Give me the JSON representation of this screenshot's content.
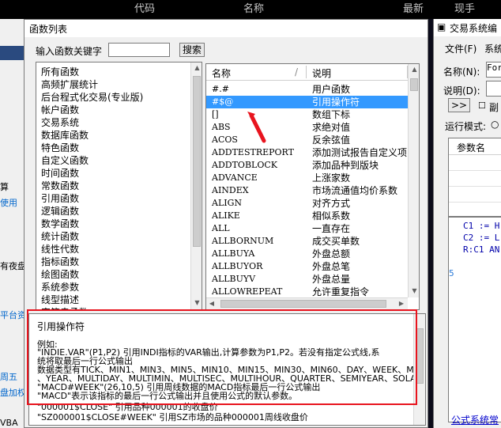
{
  "background_app": {
    "header_cols": [
      "代码",
      "名称",
      "最新",
      "现手"
    ],
    "left_side_texts": [
      "算",
      "使用",
      "有夜盘",
      "平台资",
      "周五",
      "盘加权",
      "VBA"
    ]
  },
  "dialog": {
    "title": "函数列表",
    "keyword_label": "输入函数关键字",
    "keyword_value": "",
    "search_button": "搜索",
    "categories": [
      "所有函数",
      "高频扩展统计",
      "后台程式化交易(专业版)",
      "帐户函数",
      "交易系统",
      "数据库函数",
      "特色函数",
      "自定义函数",
      "时间函数",
      "常数函数",
      "引用函数",
      "逻辑函数",
      "数学函数",
      "统计函数",
      "线性代数",
      "指标函数",
      "绘图函数",
      "系统参数",
      "线型描述",
      "字符串函数"
    ],
    "table": {
      "col_name": "名称",
      "col_desc": "说明",
      "sort_indicator": "/",
      "rows": [
        {
          "name": "#.#",
          "desc": "用户函数"
        },
        {
          "name": "#$@",
          "desc": "引用操作符"
        },
        {
          "name": "[]",
          "desc": "数组下标"
        },
        {
          "name": "ABS",
          "desc": "求绝对值"
        },
        {
          "name": "ACOS",
          "desc": "反余弦值"
        },
        {
          "name": "ADDTESTREPORT",
          "desc": "添加测试报告自定义项"
        },
        {
          "name": "ADDTOBLOCK",
          "desc": "添加品种到版块"
        },
        {
          "name": "ADVANCE",
          "desc": "上涨家数"
        },
        {
          "name": "AINDEX",
          "desc": "市场流通值均价系数"
        },
        {
          "name": "ALIGN",
          "desc": "对齐方式"
        },
        {
          "name": "ALIKE",
          "desc": "相似系数"
        },
        {
          "name": "ALL",
          "desc": "一直存在"
        },
        {
          "name": "ALLBORNUM",
          "desc": "成交买单数"
        },
        {
          "name": "ALLBUYA",
          "desc": "外盘总额"
        },
        {
          "name": "ALLBUYOR",
          "desc": "外盘总笔"
        },
        {
          "name": "ALLBUYV",
          "desc": "外盘总量"
        },
        {
          "name": "ALLOWREPEAT",
          "desc": "允许重复指令"
        }
      ],
      "selected_index": 1
    },
    "description_lines": [
      "引用操作符",
      "",
      "例如:",
      "\"INDIE.VAR\"(P1,P2) 引用INDI指标的VAR输出,计算参数为P1,P2。若没有指定公式线,系",
      "统将取最后一行公式输出",
      "数据类型有TICK、MIN1、MIN3、MIN5、MIN10、MIN15、MIN30、MIN60、DAY、WEEK、MONTH",
      "、YEAR、MULTIDAY、MULTIMIN、MULTISEC、MULTIHOUR、QUARTER、SEMIYEAR、SOLARTERM",
      "\"MACD#WEEK\"(26,10,5) 引用周线数据的MACD指标最后一行公式输出",
      "\"MACD\"表示该指标的最后一行公式输出并且使用公式的默认参数。",
      "\"000001$CLOSE\" 引用品种000001的收盘价",
      "\"SZ000001$CLOSE#WEEK\" 引用SZ市场的品种000001周线收盘价"
    ]
  },
  "right_dialog": {
    "title": "交易系统编",
    "menu_file": "文件(F)",
    "menu_sys": "系统",
    "name_label": "名称(N):",
    "name_value": "For",
    "desc_label": "说明(D):",
    "expand_button": ">>",
    "sub_label": "副",
    "run_mode_label": "运行模式:",
    "param_header": "参数名",
    "code_lines": [
      "C1 := H",
      "C2 := L",
      "R:C1 AN"
    ],
    "line_number": "5",
    "link_text": "公式系统常"
  },
  "colors": {
    "selection": "#3399ff",
    "annotation_red": "#e8141e",
    "link_blue": "#0000cc"
  }
}
